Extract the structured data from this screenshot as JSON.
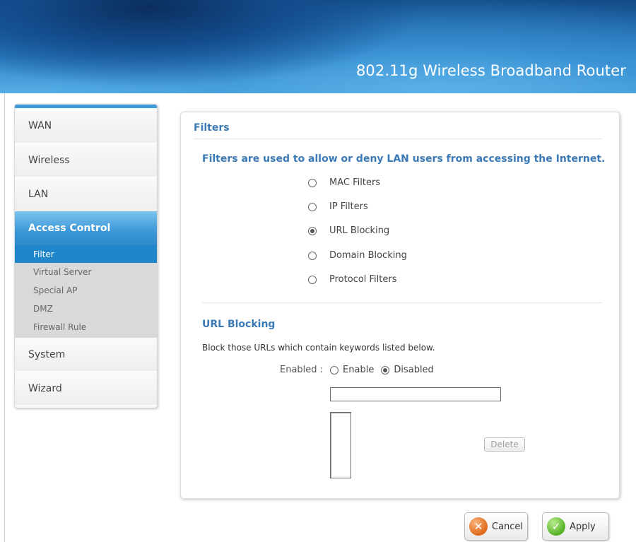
{
  "header": {
    "title": "802.11g Wireless Broadband Router"
  },
  "sidebar": {
    "items": [
      {
        "label": "WAN"
      },
      {
        "label": "Wireless"
      },
      {
        "label": "LAN"
      },
      {
        "label": "Access Control"
      },
      {
        "label": "System"
      },
      {
        "label": "Wizard"
      }
    ],
    "subitems": [
      {
        "label": "Filter"
      },
      {
        "label": "Virtual Server"
      },
      {
        "label": "Special AP"
      },
      {
        "label": "DMZ"
      },
      {
        "label": "Firewall Rule"
      }
    ]
  },
  "main": {
    "title": "Filters",
    "description": "Filters are used to allow or deny LAN users from accessing the Internet.",
    "filter_options": [
      {
        "label": "MAC Filters",
        "checked": false
      },
      {
        "label": "IP Filters",
        "checked": false
      },
      {
        "label": "URL Blocking",
        "checked": true
      },
      {
        "label": "Domain Blocking",
        "checked": false
      },
      {
        "label": "Protocol Filters",
        "checked": false
      }
    ],
    "section": {
      "title": "URL Blocking",
      "description": "Block those URLs which contain keywords listed below.",
      "enabled_label": "Enabled :",
      "enable_option": "Enable",
      "disable_option": "Disabled",
      "selected": "Disabled",
      "url_input_value": "",
      "delete_label": "Delete"
    }
  },
  "actions": {
    "cancel_label": "Cancel",
    "apply_label": "Apply"
  }
}
